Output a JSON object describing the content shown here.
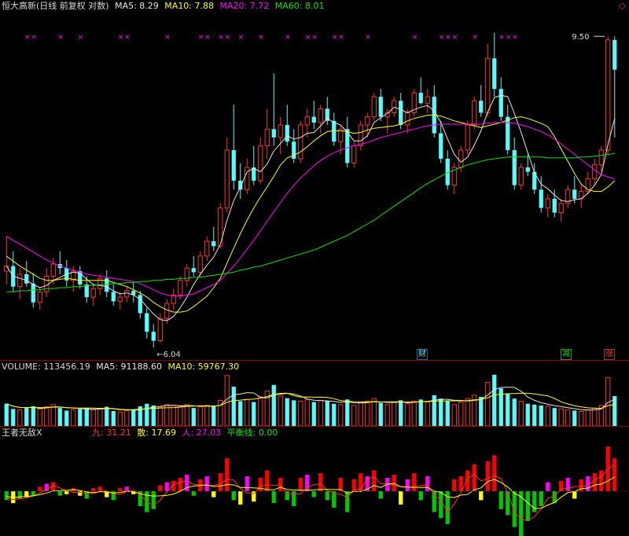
{
  "colors": {
    "up": "#ff3232",
    "down": "#54fcfc",
    "ma5": "#e6e6e6",
    "ma10": "#ffff00",
    "ma20": "#ff00ff",
    "ma60": "#00e600",
    "vol_up": "#ff3232",
    "vol_down": "#54fcfc",
    "ind_red": "#ff0000",
    "ind_magenta": "#ff00ff",
    "ind_green": "#00c800",
    "ind_yellow": "#ffff00",
    "ind_line1": "#ff3232",
    "ind_line2": "#ffff00",
    "label_white": "#d8d8d8",
    "sep": "#8b0000"
  },
  "header": {
    "title": "恒大高新(日线 前复权 对数)",
    "ma5": "MA5: 8.29",
    "ma10": "MA10: 7.88",
    "ma20": "MA20: 7.72",
    "ma60": "MA60: 8.01"
  },
  "volume_header": {
    "label": "VOLUME: 113456.19",
    "ma5": "MA5: 91188.60",
    "ma10": "MA10: 59767.30"
  },
  "indicator_header": {
    "name": "王者无敌X",
    "jiu": "九: 31.21",
    "san": "散: 17.69",
    "ren": "人: 27.03",
    "balance": "平衡线: 0.00"
  },
  "corner_icon": "diamond-icon",
  "badges": {
    "cai": "财",
    "jian": "减",
    "zhang": "涨"
  },
  "chart_data": [
    {
      "type": "candlestick",
      "title": "恒大高新(日线 前复权 对数)",
      "scale": "log",
      "annotations": {
        "high_label": "9.50",
        "low_label": "6.04"
      },
      "ohlc_approx_note": "visual estimate",
      "candles": [
        [
          6.75,
          7.1,
          6.62,
          6.8
        ],
        [
          6.8,
          6.95,
          6.55,
          6.6
        ],
        [
          6.6,
          6.78,
          6.48,
          6.72
        ],
        [
          6.72,
          6.85,
          6.6,
          6.63
        ],
        [
          6.63,
          6.73,
          6.4,
          6.45
        ],
        [
          6.45,
          6.6,
          6.38,
          6.55
        ],
        [
          6.55,
          6.78,
          6.5,
          6.7
        ],
        [
          6.7,
          6.88,
          6.62,
          6.82
        ],
        [
          6.82,
          6.95,
          6.72,
          6.78
        ],
        [
          6.78,
          6.86,
          6.6,
          6.66
        ],
        [
          6.66,
          6.8,
          6.55,
          6.75
        ],
        [
          6.75,
          6.8,
          6.58,
          6.62
        ],
        [
          6.62,
          6.7,
          6.45,
          6.5
        ],
        [
          6.5,
          6.62,
          6.42,
          6.58
        ],
        [
          6.58,
          6.72,
          6.52,
          6.68
        ],
        [
          6.68,
          6.76,
          6.5,
          6.55
        ],
        [
          6.55,
          6.62,
          6.42,
          6.46
        ],
        [
          6.46,
          6.55,
          6.38,
          6.5
        ],
        [
          6.5,
          6.6,
          6.45,
          6.56
        ],
        [
          6.56,
          6.64,
          6.45,
          6.52
        ],
        [
          6.52,
          6.56,
          6.3,
          6.35
        ],
        [
          6.35,
          6.4,
          6.12,
          6.18
        ],
        [
          6.18,
          6.25,
          6.04,
          6.1
        ],
        [
          6.1,
          6.35,
          6.08,
          6.3
        ],
        [
          6.3,
          6.48,
          6.25,
          6.44
        ],
        [
          6.44,
          6.58,
          6.38,
          6.52
        ],
        [
          6.52,
          6.7,
          6.48,
          6.66
        ],
        [
          6.66,
          6.82,
          6.6,
          6.78
        ],
        [
          6.78,
          6.9,
          6.7,
          6.74
        ],
        [
          6.74,
          6.95,
          6.7,
          6.9
        ],
        [
          6.9,
          7.1,
          6.85,
          7.05
        ],
        [
          7.05,
          7.2,
          6.95,
          7.0
        ],
        [
          7.0,
          7.45,
          6.98,
          7.4
        ],
        [
          7.4,
          8.2,
          7.35,
          8.05
        ],
        [
          8.05,
          8.6,
          7.6,
          7.7
        ],
        [
          7.7,
          7.9,
          7.5,
          7.6
        ],
        [
          7.6,
          7.95,
          7.55,
          7.85
        ],
        [
          7.85,
          8.1,
          7.65,
          7.7
        ],
        [
          7.7,
          8.2,
          7.66,
          8.1
        ],
        [
          8.1,
          8.55,
          7.95,
          8.3
        ],
        [
          8.3,
          9.0,
          8.1,
          8.2
        ],
        [
          8.2,
          8.45,
          8.0,
          8.35
        ],
        [
          8.35,
          8.6,
          8.1,
          8.15
        ],
        [
          8.15,
          8.3,
          7.9,
          7.95
        ],
        [
          7.95,
          8.4,
          7.9,
          8.35
        ],
        [
          8.35,
          8.55,
          8.2,
          8.45
        ],
        [
          8.45,
          8.65,
          8.3,
          8.38
        ],
        [
          8.38,
          8.6,
          8.25,
          8.55
        ],
        [
          8.55,
          8.7,
          8.35,
          8.4
        ],
        [
          8.4,
          8.5,
          8.1,
          8.15
        ],
        [
          8.15,
          8.35,
          8.0,
          8.3
        ],
        [
          8.3,
          8.45,
          7.85,
          7.9
        ],
        [
          7.9,
          8.15,
          7.85,
          8.1
        ],
        [
          8.1,
          8.4,
          8.05,
          8.35
        ],
        [
          8.35,
          8.5,
          8.2,
          8.45
        ],
        [
          8.45,
          8.75,
          8.4,
          8.7
        ],
        [
          8.7,
          8.8,
          8.4,
          8.45
        ],
        [
          8.45,
          8.55,
          8.25,
          8.5
        ],
        [
          8.5,
          8.7,
          8.45,
          8.65
        ],
        [
          8.65,
          8.75,
          8.3,
          8.35
        ],
        [
          8.35,
          8.55,
          8.25,
          8.5
        ],
        [
          8.5,
          8.8,
          8.45,
          8.75
        ],
        [
          8.75,
          8.95,
          8.6,
          8.62
        ],
        [
          8.62,
          8.8,
          8.5,
          8.7
        ],
        [
          8.7,
          8.85,
          8.2,
          8.25
        ],
        [
          8.25,
          8.4,
          7.9,
          7.95
        ],
        [
          7.95,
          8.05,
          7.6,
          7.65
        ],
        [
          7.65,
          7.9,
          7.55,
          7.85
        ],
        [
          7.85,
          8.1,
          7.8,
          8.05
        ],
        [
          8.05,
          8.4,
          8.0,
          8.35
        ],
        [
          8.35,
          8.7,
          8.3,
          8.65
        ],
        [
          8.65,
          8.85,
          8.45,
          8.5
        ],
        [
          8.5,
          9.4,
          8.45,
          9.2
        ],
        [
          9.2,
          9.55,
          8.7,
          8.8
        ],
        [
          8.8,
          8.95,
          8.4,
          8.45
        ],
        [
          8.45,
          8.6,
          8.0,
          8.05
        ],
        [
          8.05,
          8.2,
          7.6,
          7.65
        ],
        [
          7.65,
          7.9,
          7.6,
          7.85
        ],
        [
          7.85,
          8.0,
          7.75,
          7.8
        ],
        [
          7.8,
          7.9,
          7.55,
          7.6
        ],
        [
          7.6,
          7.75,
          7.35,
          7.4
        ],
        [
          7.4,
          7.55,
          7.3,
          7.5
        ],
        [
          7.5,
          7.6,
          7.3,
          7.35
        ],
        [
          7.35,
          7.5,
          7.25,
          7.45
        ],
        [
          7.45,
          7.65,
          7.4,
          7.6
        ],
        [
          7.6,
          7.75,
          7.45,
          7.5
        ],
        [
          7.5,
          7.65,
          7.4,
          7.58
        ],
        [
          7.58,
          7.8,
          7.55,
          7.72
        ],
        [
          7.72,
          7.95,
          7.65,
          7.88
        ],
        [
          7.88,
          8.1,
          7.8,
          8.05
        ],
        [
          8.05,
          9.5,
          8.0,
          9.45
        ],
        [
          9.45,
          9.5,
          8.2,
          9.05
        ]
      ],
      "series": [
        {
          "name": "MA5",
          "values": [
            6.8,
            6.7,
            6.68,
            6.66,
            6.62,
            6.59,
            6.61,
            6.66,
            6.69,
            6.72,
            6.74,
            6.73,
            6.67,
            6.62,
            6.61,
            6.6,
            6.56,
            6.53,
            6.54,
            6.52,
            6.48,
            6.41,
            6.34,
            6.29,
            6.28,
            6.32,
            6.4,
            6.5,
            6.62,
            6.72,
            6.81,
            6.89,
            7.02,
            7.27,
            7.48,
            7.63,
            7.8,
            7.84,
            7.8,
            7.89,
            8.04,
            8.13,
            8.22,
            8.18,
            8.2,
            8.25,
            8.26,
            8.34,
            8.43,
            8.38,
            8.35,
            8.26,
            8.16,
            8.16,
            8.22,
            8.38,
            8.44,
            8.49,
            8.57,
            8.54,
            8.5,
            8.54,
            8.57,
            8.59,
            8.52,
            8.38,
            8.18,
            8.0,
            7.91,
            7.97,
            8.11,
            8.28,
            8.51,
            8.69,
            8.72,
            8.7,
            8.49,
            8.26,
            8.02,
            7.79,
            7.66,
            7.61,
            7.54,
            7.48,
            7.47,
            7.49,
            7.5,
            7.56,
            7.65,
            7.77,
            8.12,
            8.43
          ]
        },
        {
          "name": "MA10",
          "values": [
            6.9,
            6.85,
            6.8,
            6.76,
            6.72,
            6.68,
            6.66,
            6.66,
            6.67,
            6.68,
            6.67,
            6.66,
            6.66,
            6.66,
            6.66,
            6.66,
            6.64,
            6.62,
            6.6,
            6.57,
            6.54,
            6.5,
            6.45,
            6.41,
            6.38,
            6.36,
            6.36,
            6.37,
            6.41,
            6.46,
            6.51,
            6.59,
            6.68,
            6.83,
            6.98,
            7.13,
            7.27,
            7.4,
            7.52,
            7.63,
            7.75,
            7.88,
            7.96,
            7.99,
            8.03,
            8.09,
            8.16,
            8.22,
            8.27,
            8.28,
            8.28,
            8.27,
            8.25,
            8.26,
            8.29,
            8.31,
            8.32,
            8.33,
            8.34,
            8.36,
            8.4,
            8.43,
            8.45,
            8.47,
            8.47,
            8.46,
            8.43,
            8.4,
            8.38,
            8.36,
            8.34,
            8.32,
            8.34,
            8.36,
            8.38,
            8.41,
            8.44,
            8.45,
            8.43,
            8.4,
            8.37,
            8.33,
            8.21,
            8.06,
            7.92,
            7.78,
            7.66,
            7.6,
            7.58,
            7.58,
            7.63,
            7.7
          ]
        },
        {
          "name": "MA20",
          "values": [
            7.1,
            7.06,
            7.02,
            6.98,
            6.94,
            6.9,
            6.86,
            6.83,
            6.8,
            6.78,
            6.76,
            6.74,
            6.72,
            6.71,
            6.7,
            6.69,
            6.68,
            6.67,
            6.66,
            6.65,
            6.63,
            6.6,
            6.57,
            6.54,
            6.52,
            6.51,
            6.51,
            6.52,
            6.53,
            6.56,
            6.59,
            6.62,
            6.66,
            6.73,
            6.8,
            6.88,
            6.97,
            7.06,
            7.16,
            7.26,
            7.36,
            7.46,
            7.56,
            7.65,
            7.73,
            7.8,
            7.87,
            7.93,
            7.98,
            8.02,
            8.05,
            8.08,
            8.1,
            8.12,
            8.14,
            8.17,
            8.2,
            8.22,
            8.24,
            8.26,
            8.28,
            8.3,
            8.32,
            8.34,
            8.35,
            8.36,
            8.36,
            8.36,
            8.36,
            8.36,
            8.36,
            8.36,
            8.37,
            8.38,
            8.38,
            8.38,
            8.37,
            8.35,
            8.33,
            8.3,
            8.27,
            8.23,
            8.18,
            8.12,
            8.06,
            8.0,
            7.94,
            7.88,
            7.82,
            7.77,
            7.74,
            7.72
          ]
        },
        {
          "name": "MA60",
          "values": [
            6.55,
            6.55,
            6.56,
            6.56,
            6.57,
            6.57,
            6.58,
            6.58,
            6.59,
            6.59,
            6.6,
            6.6,
            6.61,
            6.61,
            6.62,
            6.62,
            6.63,
            6.63,
            6.64,
            6.64,
            6.65,
            6.65,
            6.66,
            6.66,
            6.67,
            6.67,
            6.68,
            6.68,
            6.69,
            6.69,
            6.7,
            6.71,
            6.72,
            6.73,
            6.74,
            6.76,
            6.77,
            6.79,
            6.8,
            6.82,
            6.84,
            6.86,
            6.88,
            6.9,
            6.92,
            6.94,
            6.96,
            6.99,
            7.02,
            7.05,
            7.08,
            7.11,
            7.15,
            7.19,
            7.23,
            7.27,
            7.32,
            7.37,
            7.42,
            7.47,
            7.52,
            7.57,
            7.62,
            7.67,
            7.71,
            7.75,
            7.79,
            7.82,
            7.85,
            7.88,
            7.9,
            7.92,
            7.94,
            7.95,
            7.96,
            7.97,
            7.97,
            7.97,
            7.97,
            7.97,
            7.97,
            7.96,
            7.96,
            7.96,
            7.96,
            7.96,
            7.97,
            7.97,
            7.98,
            7.99,
            8.0,
            8.01
          ]
        }
      ]
    },
    {
      "type": "bar",
      "title": "VOLUME",
      "values": [
        52000,
        40000,
        38000,
        42000,
        46000,
        40000,
        45000,
        50000,
        42000,
        36000,
        38000,
        40000,
        42000,
        38000,
        40000,
        45000,
        35000,
        33000,
        36000,
        38000,
        46000,
        52000,
        48000,
        44000,
        50000,
        48000,
        46000,
        50000,
        42000,
        45000,
        48000,
        46000,
        60000,
        118000,
        92000,
        58000,
        62000,
        56000,
        68000,
        82000,
        96000,
        70000,
        65000,
        60000,
        58000,
        62000,
        56000,
        60000,
        58000,
        52000,
        50000,
        62000,
        48000,
        56000,
        58000,
        64000,
        54000,
        50000,
        56000,
        60000,
        52000,
        58000,
        62000,
        56000,
        72000,
        64000,
        58000,
        50000,
        56000,
        64000,
        72000,
        68000,
        102000,
        120000,
        88000,
        76000,
        64000,
        58000,
        52000,
        50000,
        48000,
        46000,
        42000,
        40000,
        38000,
        36000,
        34000,
        38000,
        42000,
        48000,
        113456,
        70000
      ],
      "up_flags": [
        0,
        0,
        1,
        0,
        0,
        1,
        1,
        1,
        0,
        0,
        1,
        0,
        0,
        1,
        1,
        0,
        0,
        1,
        1,
        0,
        0,
        0,
        0,
        1,
        1,
        1,
        1,
        1,
        0,
        1,
        1,
        0,
        1,
        1,
        0,
        0,
        1,
        0,
        1,
        1,
        0,
        1,
        0,
        0,
        1,
        1,
        0,
        1,
        0,
        0,
        1,
        0,
        1,
        1,
        1,
        1,
        0,
        1,
        1,
        0,
        1,
        1,
        0,
        1,
        0,
        0,
        0,
        1,
        1,
        1,
        1,
        0,
        1,
        0,
        0,
        0,
        0,
        1,
        0,
        0,
        0,
        1,
        0,
        1,
        1,
        0,
        1,
        1,
        1,
        1,
        1,
        0
      ],
      "ma5_label": "MA5: 91188.60",
      "ma10_label": "MA10: 59767.30"
    },
    {
      "type": "bar",
      "title": "王者无敌X",
      "values": [
        -6,
        -8,
        -5,
        -4,
        -3,
        3,
        5,
        6,
        -3,
        -2,
        2,
        -3,
        -5,
        2,
        3,
        -4,
        -6,
        2,
        3,
        -2,
        -10,
        -14,
        -12,
        4,
        6,
        7,
        9,
        11,
        -3,
        8,
        10,
        -4,
        12,
        22,
        -6,
        -9,
        10,
        -7,
        9,
        14,
        -8,
        9,
        -6,
        -10,
        9,
        11,
        -4,
        12,
        -6,
        -11,
        9,
        -14,
        8,
        12,
        10,
        14,
        -5,
        9,
        11,
        -9,
        8,
        12,
        -6,
        10,
        -14,
        -18,
        -22,
        8,
        10,
        14,
        18,
        -6,
        20,
        24,
        -12,
        -16,
        -24,
        -30,
        -20,
        -14,
        -10,
        6,
        -8,
        7,
        9,
        -5,
        8,
        10,
        12,
        14,
        30,
        22
      ],
      "line1_label": "九: 31.21",
      "line2_label": "散: 17.69",
      "line3_label": "人: 27.03",
      "balance_label": "平衡线: 0.00"
    }
  ]
}
